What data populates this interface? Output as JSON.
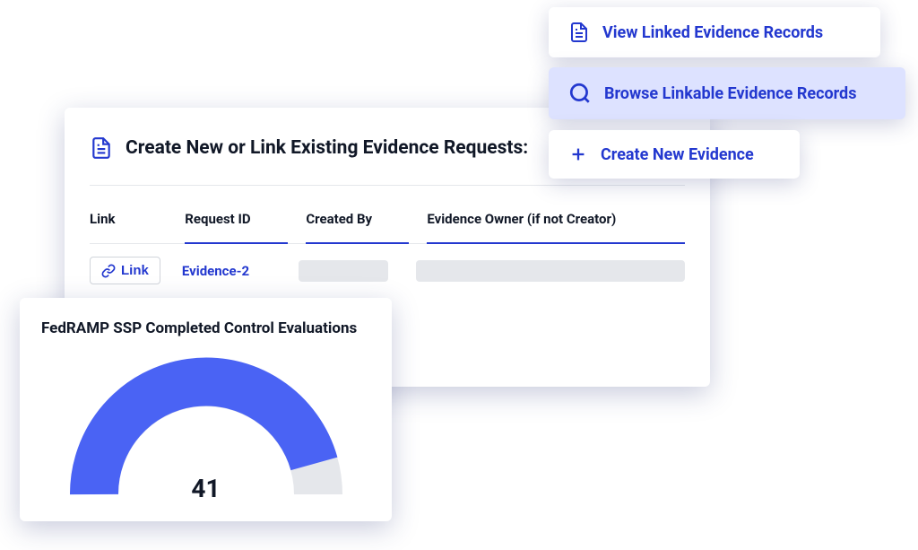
{
  "header": {
    "title": "Create New or Link Existing Evidence Requests:"
  },
  "table": {
    "columns": {
      "link": "Link",
      "request_id": "Request ID",
      "created_by": "Created By",
      "evidence_owner": "Evidence Owner (if not Creator)"
    },
    "rows": [
      {
        "link_label": "Link",
        "request_id": "Evidence-2",
        "created_by": "",
        "evidence_owner": ""
      }
    ]
  },
  "gauge": {
    "title": "FedRAMP SSP Completed Control Evaluations",
    "value": "41"
  },
  "chart_data": {
    "type": "gauge",
    "title": "FedRAMP SSP Completed Control Evaluations",
    "value": 41,
    "max": 45,
    "percent": 91
  },
  "menu": {
    "view_linked": "View Linked Evidence Records",
    "browse_linkable": "Browse Linkable Evidence Records",
    "create_new": "Create New Evidence"
  },
  "colors": {
    "primary": "#2338cf",
    "primary_light": "#dde2ff",
    "accent": "#4a63f4",
    "gray_bg": "#e5e7eb"
  }
}
